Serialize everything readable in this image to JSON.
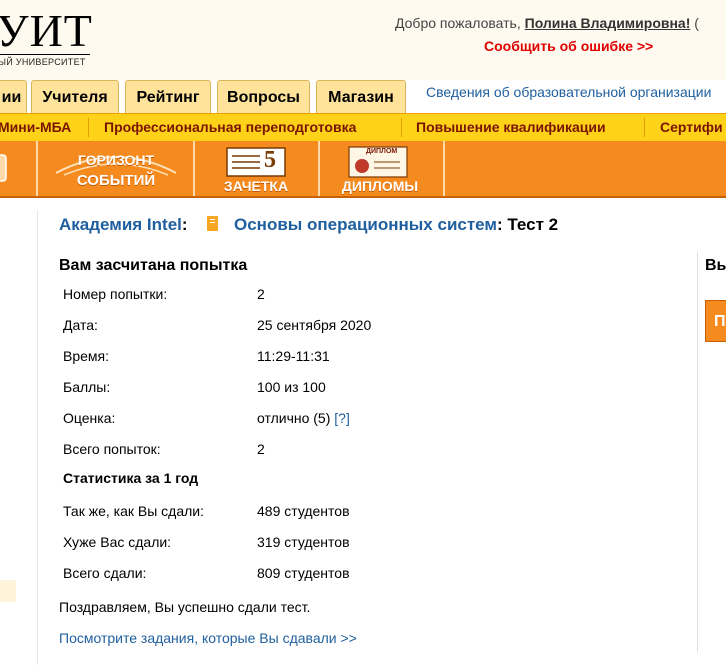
{
  "header": {
    "logo_text": "УИТ",
    "logo_subtitle": "ЫЙ УНИВЕРСИТЕТ",
    "welcome_prefix": "Добро пожаловать, ",
    "user_name": "Полина Владимировна!",
    "welcome_suffix": " (",
    "report_error": "Сообщить об ошибке >>"
  },
  "tabs": [
    "ии",
    "Учителя",
    "Рейтинг",
    "Вопросы",
    "Магазин"
  ],
  "info_link": "Сведения об образовательной организации",
  "nav1": [
    "Мини-МБА",
    "Профессиональная переподготовка",
    "Повышение квалификации",
    "Сертифи"
  ],
  "nav2": {
    "horizon_line1": "ГОРИЗОНТ",
    "horizon_line2": "СОБЫТИЙ",
    "zachetka_number": "5",
    "zachetka": "ЗАЧЕТКА",
    "diplom_badge": "ДИПЛОМ",
    "diplomy": "ДИПЛОМЫ"
  },
  "breadcrumb": {
    "academy": "Академия Intel",
    "colon1": ":",
    "course": "Основы операционных систем",
    "colon2": ":",
    "test": " Тест 2"
  },
  "result": {
    "title": "Вам засчитана попытка",
    "rows": [
      {
        "label": "Номер попытки:",
        "value": "2"
      },
      {
        "label": "Дата:",
        "value": "25 сентября 2020"
      },
      {
        "label": "Время:",
        "value": "11:29-11:31"
      },
      {
        "label": "Баллы:",
        "value": "100 из 100"
      },
      {
        "label": "Оценка:",
        "value": "отлично (5)",
        "help": "[?]"
      },
      {
        "label": "Всего попыток:",
        "value": "2"
      }
    ],
    "stats_title": "Статистика за 1 год",
    "stats": [
      {
        "label": "Так же, как Вы сдали:",
        "value": "489 студентов"
      },
      {
        "label": "Хуже Вас сдали:",
        "value": "319 студентов"
      },
      {
        "label": "Всего сдали:",
        "value": "809 студентов"
      }
    ],
    "congrats": "Поздравляем, Вы успешно сдали тест.",
    "view_tasks": "Посмотрите задания, которые Вы сдавали >>"
  },
  "right_panel": {
    "heading": "Вы",
    "button": "П"
  },
  "colors": {
    "accent_orange": "#f58a1f",
    "nav_yellow": "#ffd21a",
    "link_blue": "#1f5f9f",
    "error_red": "#e00000"
  }
}
